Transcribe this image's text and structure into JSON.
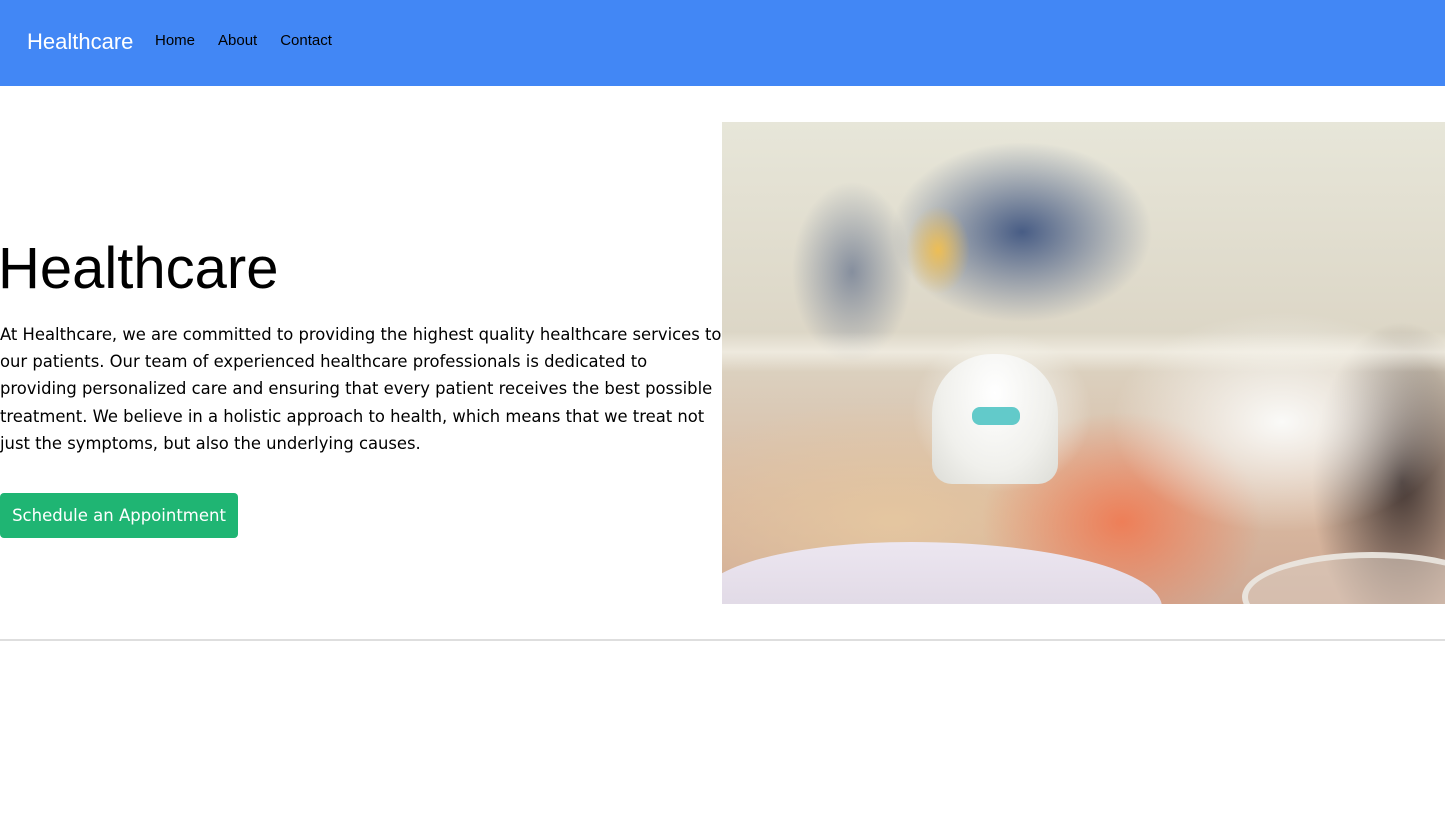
{
  "navbar": {
    "brand": "Healthcare",
    "links": [
      {
        "label": "Home"
      },
      {
        "label": "About"
      },
      {
        "label": "Contact"
      }
    ],
    "background_color": "#4287f5"
  },
  "hero": {
    "title": "Healthcare",
    "description": "At Healthcare, we are committed to providing the highest quality healthcare services to our patients. Our team of experienced healthcare professionals is dedicated to providing personalized care and ensuring that every patient receives the best possible treatment. We believe in a holistic approach to health, which means that we treat not just the symptoms, but also the underlying causes.",
    "cta_label": "Schedule an Appointment",
    "cta_color": "#1fb573",
    "image_subject": "blurred-laboratory-photo"
  }
}
